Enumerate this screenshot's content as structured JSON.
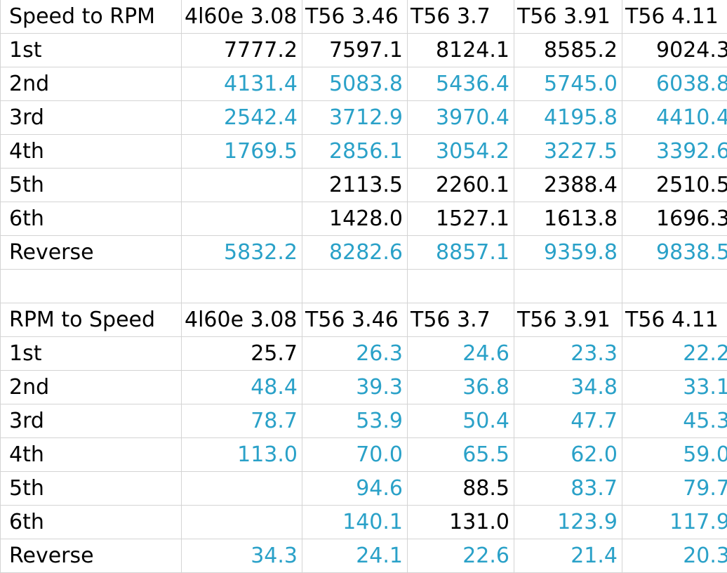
{
  "colors": {
    "black": "#000000",
    "blue": "#2aa1c8",
    "grid": "#d4d4d4"
  },
  "tables": [
    {
      "title": "Speed to RPM",
      "columns": [
        "4l60e 3.08",
        "T56 3.46",
        "T56 3.7",
        "T56 3.91",
        "T56 4.11"
      ],
      "rows": [
        {
          "label": "1st",
          "values": [
            "7777.2",
            "7597.1",
            "8124.1",
            "8585.2",
            "9024.3"
          ],
          "colors": [
            "black",
            "black",
            "black",
            "black",
            "black"
          ]
        },
        {
          "label": "2nd",
          "values": [
            "4131.4",
            "5083.8",
            "5436.4",
            "5745.0",
            "6038.8"
          ],
          "colors": [
            "blue",
            "blue",
            "blue",
            "blue",
            "blue"
          ]
        },
        {
          "label": "3rd",
          "values": [
            "2542.4",
            "3712.9",
            "3970.4",
            "4195.8",
            "4410.4"
          ],
          "colors": [
            "blue",
            "blue",
            "blue",
            "blue",
            "blue"
          ]
        },
        {
          "label": "4th",
          "values": [
            "1769.5",
            "2856.1",
            "3054.2",
            "3227.5",
            "3392.6"
          ],
          "colors": [
            "blue",
            "blue",
            "blue",
            "blue",
            "blue"
          ]
        },
        {
          "label": "5th",
          "values": [
            "",
            "2113.5",
            "2260.1",
            "2388.4",
            "2510.5"
          ],
          "colors": [
            "black",
            "black",
            "black",
            "black",
            "black"
          ]
        },
        {
          "label": "6th",
          "values": [
            "",
            "1428.0",
            "1527.1",
            "1613.8",
            "1696.3"
          ],
          "colors": [
            "black",
            "black",
            "black",
            "black",
            "black"
          ]
        },
        {
          "label": "Reverse",
          "values": [
            "5832.2",
            "8282.6",
            "8857.1",
            "9359.8",
            "9838.5"
          ],
          "colors": [
            "blue",
            "blue",
            "blue",
            "blue",
            "blue"
          ]
        }
      ]
    },
    {
      "title": "RPM to Speed",
      "columns": [
        "4l60e 3.08",
        "T56 3.46",
        "T56 3.7",
        "T56 3.91",
        "T56 4.11"
      ],
      "rows": [
        {
          "label": "1st",
          "values": [
            "25.7",
            "26.3",
            "24.6",
            "23.3",
            "22.2"
          ],
          "colors": [
            "black",
            "blue",
            "blue",
            "blue",
            "blue"
          ]
        },
        {
          "label": "2nd",
          "values": [
            "48.4",
            "39.3",
            "36.8",
            "34.8",
            "33.1"
          ],
          "colors": [
            "blue",
            "blue",
            "blue",
            "blue",
            "blue"
          ]
        },
        {
          "label": "3rd",
          "values": [
            "78.7",
            "53.9",
            "50.4",
            "47.7",
            "45.3"
          ],
          "colors": [
            "blue",
            "blue",
            "blue",
            "blue",
            "blue"
          ]
        },
        {
          "label": "4th",
          "values": [
            "113.0",
            "70.0",
            "65.5",
            "62.0",
            "59.0"
          ],
          "colors": [
            "blue",
            "blue",
            "blue",
            "blue",
            "blue"
          ]
        },
        {
          "label": "5th",
          "values": [
            "",
            "94.6",
            "88.5",
            "83.7",
            "79.7"
          ],
          "colors": [
            "black",
            "blue",
            "black",
            "blue",
            "blue"
          ]
        },
        {
          "label": "6th",
          "values": [
            "",
            "140.1",
            "131.0",
            "123.9",
            "117.9"
          ],
          "colors": [
            "black",
            "blue",
            "black",
            "blue",
            "blue"
          ]
        },
        {
          "label": "Reverse",
          "values": [
            "34.3",
            "24.1",
            "22.6",
            "21.4",
            "20.3"
          ],
          "colors": [
            "blue",
            "blue",
            "blue",
            "blue",
            "blue"
          ]
        }
      ]
    }
  ]
}
